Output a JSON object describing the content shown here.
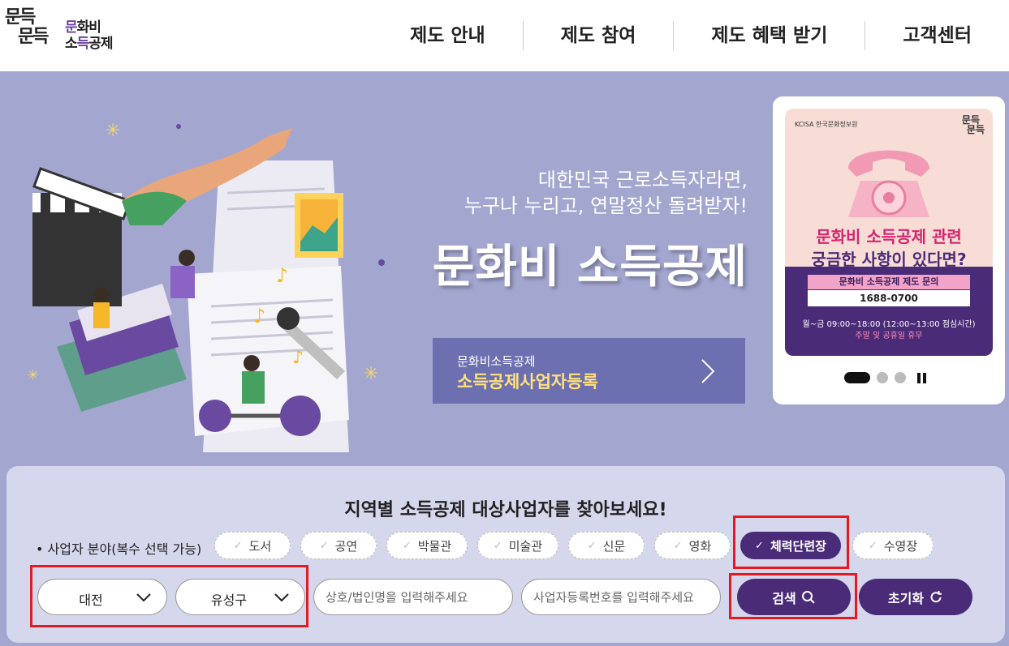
{
  "logo": {
    "mun": "문득\n문득",
    "line1_pre": "",
    "line1_p": "문",
    "line1_post": "화비",
    "line2_pre": "소",
    "line2_p": "득",
    "line2_post": "공제"
  },
  "nav": [
    "제도 안내",
    "제도 참여",
    "제도 혜택 받기",
    "고객센터"
  ],
  "hero": {
    "tagline1": "대한민국 근로소득자라면,",
    "tagline2": "누구나 누리고, 연말정산 돌려받자!",
    "title": "문화비 소득공제",
    "register_small": "문화비소득공제",
    "register_big": "소득공제사업자등록"
  },
  "banner": {
    "org": "KCISA 한국문화정보원",
    "logo": "문득\n문득",
    "line1_highlight": "문화비 소득공제",
    "line1_rest": " 관련",
    "line2": "궁금한 사항이 있다면?",
    "pill1": "문화비 소득공제 제도 문의",
    "phone": "1688-0700",
    "hours": "월~금 09:00~18:00 (12:00~13:00 점심시간)",
    "holiday": "주말 및 공휴일 휴무"
  },
  "search": {
    "title": "지역별 소득공제 대상사업자를 찾아보세요!",
    "category_label": "• 사업자 분야(복수 선택 가능)",
    "categories": [
      {
        "label": "도서",
        "selected": false
      },
      {
        "label": "공연",
        "selected": false
      },
      {
        "label": "박물관",
        "selected": false
      },
      {
        "label": "미술관",
        "selected": false
      },
      {
        "label": "신문",
        "selected": false
      },
      {
        "label": "영화",
        "selected": false
      },
      {
        "label": "체력단련장",
        "selected": true
      },
      {
        "label": "수영장",
        "selected": false
      }
    ],
    "region": "대전",
    "district": "유성구",
    "name_placeholder": "상호/법인명을 입력해주세요",
    "bizno_placeholder": "사업자등록번호를 입력해주세요",
    "search_label": "검색",
    "reset_label": "초기화"
  },
  "colors": {
    "accent": "#4a2b78",
    "hero_bg": "#a3a6cf",
    "highlight_box": "#e8181c"
  }
}
